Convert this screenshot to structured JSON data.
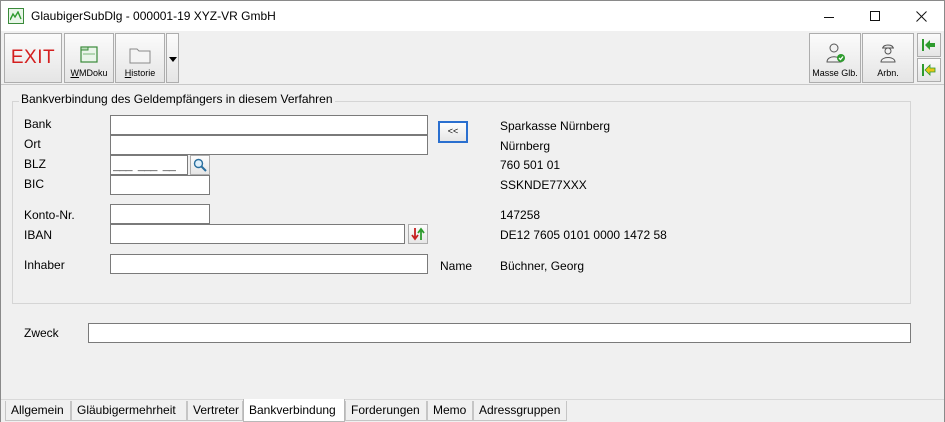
{
  "window": {
    "title": "GlaubigerSubDlg - 000001-19 XYZ-VR GmbH"
  },
  "toolbar": {
    "exit_label": "EXIT",
    "wmdoku_label_underlined": "W",
    "wmdoku_label_rest": "MDoku",
    "historie_label_underlined": "H",
    "historie_label_rest": "istorie",
    "masse_label": "Masse Glb.",
    "arbn_label": "Arbn."
  },
  "group": {
    "title": "Bankverbindung des Geldempfängers in diesem Verfahren"
  },
  "fields": {
    "bank_label": "Bank",
    "ort_label": "Ort",
    "blz_label": "BLZ",
    "blz_mask": "___ ___ __",
    "bic_label": "BIC",
    "konto_label": "Konto-Nr.",
    "iban_label": "IBAN",
    "inhaber_label": "Inhaber",
    "name_label": "Name",
    "copy_button": "<<",
    "zweck_label": "Zweck",
    "bank_value": "",
    "ort_value": "",
    "bic_value": "",
    "konto_value": "",
    "iban_value": "",
    "inhaber_value": "",
    "zweck_value": ""
  },
  "reference": {
    "bank": "Sparkasse Nürnberg",
    "ort": "Nürnberg",
    "blz": "760 501 01",
    "bic": "SSKNDE77XXX",
    "konto": "147258",
    "iban": "DE12 7605 0101 0000 1472 58",
    "name": "Büchner, Georg"
  },
  "tabs": [
    {
      "label": "Allgemein"
    },
    {
      "label": "Gläubigermehrheit"
    },
    {
      "label": "Vertreter"
    },
    {
      "label": "Bankverbindung"
    },
    {
      "label": "Forderungen"
    },
    {
      "label": "Memo"
    },
    {
      "label": "Adressgruppen"
    }
  ],
  "colors": {
    "exit": "#d41f1f",
    "accent_green": "#2e9b2e",
    "focus_blue": "#2a6fcf"
  }
}
